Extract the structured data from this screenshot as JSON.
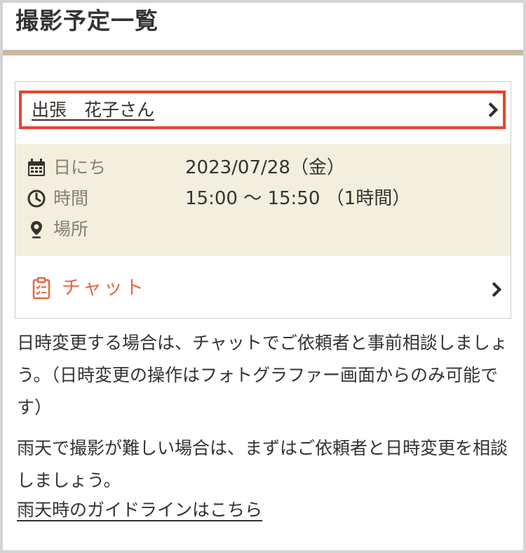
{
  "header": {
    "title": "撮影予定一覧"
  },
  "appointment": {
    "client_name": "出張　花子さん",
    "details": {
      "date": {
        "label": "日にち",
        "value": "2023/07/28（金）",
        "icon": "calendar-icon"
      },
      "time": {
        "label": "時間",
        "value": "15:00 〜 15:50 （1時間）",
        "icon": "clock-icon"
      },
      "place": {
        "label": "場所",
        "value": "",
        "icon": "location-pin-icon"
      }
    },
    "chat": {
      "label": "チャット",
      "icon": "clipboard-icon"
    }
  },
  "notices": {
    "reschedule": "日時変更する場合は、チャットでご依頼者と事前相談しましょう。（日時変更の操作はフォトグラファー画面からのみ可能です）",
    "rain": "雨天で撮影が難しい場合は、まずはご依頼者と日時変更を相談しましょう。",
    "guideline_link": "雨天時のガイドラインはこちら"
  },
  "colors": {
    "accent_border": "#e8432e",
    "header_rule": "#c9b8a6",
    "info_background": "#f3efdf",
    "chat_accent": "#e5673f"
  }
}
